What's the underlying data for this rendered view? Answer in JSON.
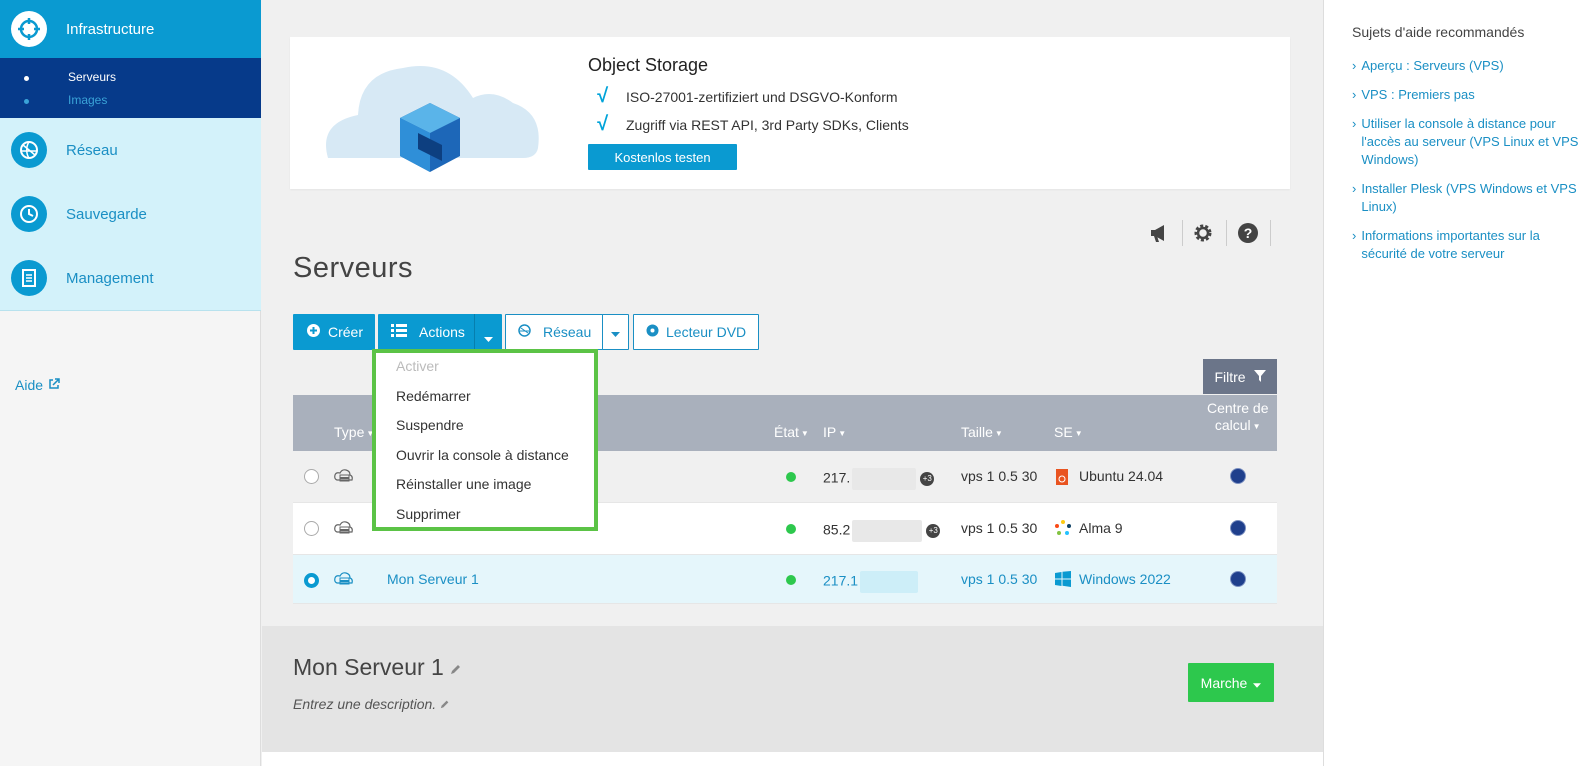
{
  "sidebar": {
    "items": [
      {
        "label": "Infrastructure",
        "icon": "infrastructure-icon"
      },
      {
        "label": "Réseau",
        "icon": "network-icon"
      },
      {
        "label": "Sauvegarde",
        "icon": "backup-icon"
      },
      {
        "label": "Management",
        "icon": "management-icon"
      }
    ],
    "subitems": [
      {
        "label": "Serveurs"
      },
      {
        "label": "Images"
      }
    ],
    "help_label": "Aide"
  },
  "banner": {
    "title": "Object Storage",
    "features": [
      "ISO-27001-zertifiziert und DSGVO-Konform",
      "Zugriff via REST API, 3rd Party SDKs, Clients"
    ],
    "button": "Kostenlos testen"
  },
  "page": {
    "title": "Serveurs"
  },
  "toolbar": {
    "create": "Créer",
    "actions": "Actions",
    "network": "Réseau",
    "dvd": "Lecteur DVD",
    "filter": "Filtre"
  },
  "actions_menu": {
    "items": [
      "Activer",
      "Redémarrer",
      "Suspendre",
      "Ouvrir la console à distance",
      "Réinstaller une image",
      "Supprimer"
    ]
  },
  "table": {
    "headers": {
      "type": "Type",
      "state": "État",
      "ip": "IP",
      "size": "Taille",
      "os": "SE",
      "datacenter_line1": "Centre de",
      "datacenter_line2": "calcul"
    },
    "rows": [
      {
        "name": "",
        "ip": "217.",
        "extra": "+3",
        "size": "vps 1 0.5 30",
        "os": "Ubuntu 24.04"
      },
      {
        "name": "",
        "ip": "85.2",
        "extra": "+3",
        "size": "vps 1 0.5 30",
        "os": "Alma 9"
      },
      {
        "name": "Mon Serveur 1",
        "ip": "217.1",
        "extra": "",
        "size": "vps 1 0.5 30",
        "os": "Windows 2022"
      }
    ]
  },
  "detail": {
    "title": "Mon Serveur 1",
    "description": "Entrez une description.",
    "status_button": "Marche"
  },
  "help": {
    "title": "Sujets d'aide recommandés",
    "links": [
      "Aperçu : Serveurs (VPS)",
      "VPS : Premiers pas",
      "Utiliser la console à distance pour l'accès au serveur (VPS Linux et VPS Windows)",
      "Installer Plesk (VPS Windows et VPS Linux)",
      "Informations importantes sur la sécurité de votre serveur"
    ]
  },
  "colors": {
    "accent": "#0a9ad1",
    "nav_dark": "#063a8a",
    "nav_light": "#d3f2fa",
    "success": "#2dc84d",
    "highlight": "#5bc346"
  }
}
